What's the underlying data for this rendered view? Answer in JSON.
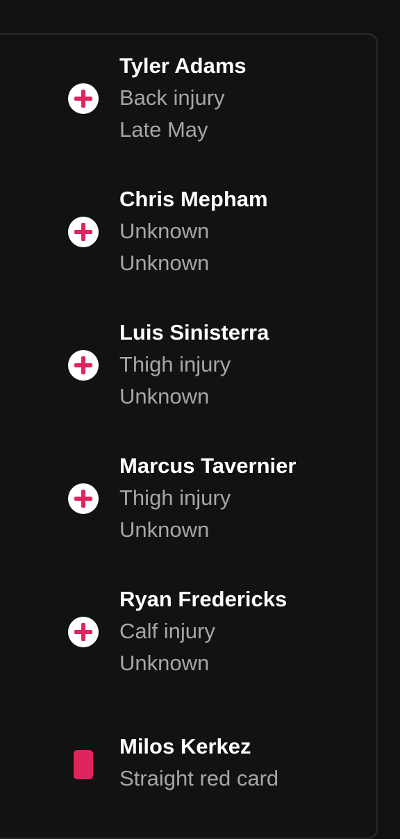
{
  "players": [
    {
      "name": "Tyler Adams",
      "reason": "Back injury",
      "return": "Late May",
      "icon": "injury-icon"
    },
    {
      "name": "Chris Mepham",
      "reason": "Unknown",
      "return": "Unknown",
      "icon": "injury-icon"
    },
    {
      "name": "Luis Sinisterra",
      "reason": "Thigh injury",
      "return": "Unknown",
      "icon": "injury-icon"
    },
    {
      "name": "Marcus Tavernier",
      "reason": "Thigh injury",
      "return": "Unknown",
      "icon": "injury-icon"
    },
    {
      "name": "Ryan Fredericks",
      "reason": "Calf injury",
      "return": "Unknown",
      "icon": "injury-icon"
    },
    {
      "name": "Milos Kerkez",
      "reason": "Straight red card",
      "icon": "red-card-icon"
    }
  ],
  "colors": {
    "accent": "#e0245e",
    "background": "#121212",
    "name_text": "#ffffff",
    "detail_text": "#a6a6a6"
  }
}
